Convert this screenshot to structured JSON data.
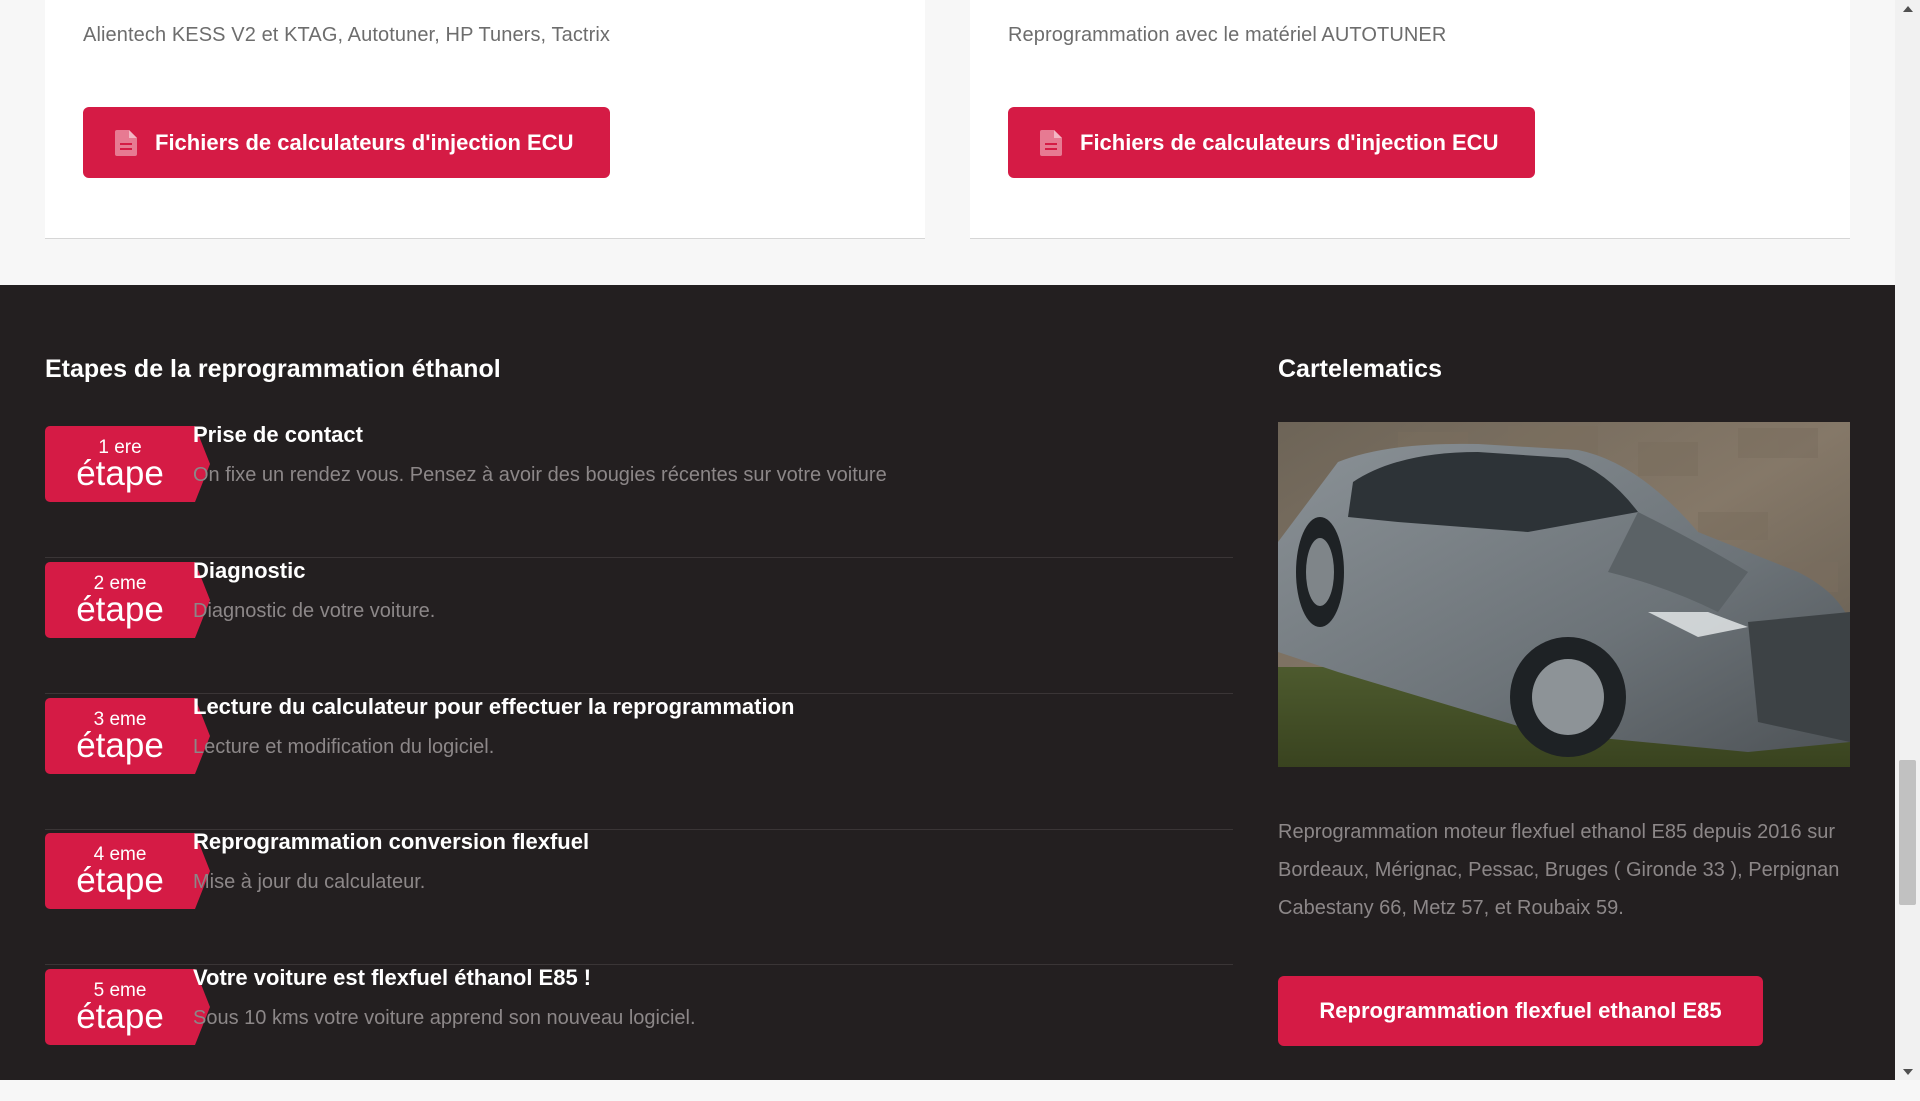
{
  "cards": [
    {
      "text": "Alientech KESS V2 et KTAG, Autotuner, HP Tuners, Tactrix",
      "button_label": "Fichiers de calculateurs d'injection ECU",
      "button_icon": "file-document-icon"
    },
    {
      "text": "Reprogrammation avec le matériel AUTOTUNER",
      "button_label": "Fichiers de calculateurs d'injection ECU",
      "button_icon": "file-document-icon"
    }
  ],
  "steps_section": {
    "title": "Etapes de la reprogrammation éthanol",
    "steps": [
      {
        "number": "1 ere",
        "word": "étape",
        "title": "Prise de contact",
        "description": "On fixe un rendez vous. Pensez à avoir des bougies récentes sur votre voiture"
      },
      {
        "number": "2 eme",
        "word": "étape",
        "title": "Diagnostic",
        "description": "Diagnostic de votre voiture."
      },
      {
        "number": "3 eme",
        "word": "étape",
        "title": "Lecture du calculateur pour effectuer la reprogrammation",
        "description": "Lecture et modification du logiciel."
      },
      {
        "number": "4 eme",
        "word": "étape",
        "title": "Reprogrammation conversion flexfuel",
        "description": "Mise à jour du calculateur."
      },
      {
        "number": "5 eme",
        "word": "étape",
        "title": "Votre voiture est flexfuel éthanol E85 !",
        "description": "Sous 10 kms votre voiture apprend son nouveau logiciel."
      }
    ]
  },
  "cartelematics": {
    "title": "Cartelematics",
    "photo": "grey-audi-wagon-photo",
    "text": "Reprogrammation moteur flexfuel ethanol E85 depuis 2016 sur Bordeaux, Mérignac, Pessac, Bruges ( Gironde 33 ), Perpignan Cabestany 66, Metz 57, et Roubaix 59.",
    "button_label": "Reprogrammation flexfuel ethanol E85"
  },
  "colors": {
    "accent": "#d51b45",
    "dark_bg": "#231f20",
    "light_bg": "#f7f7f7",
    "muted_text": "#8c8788"
  }
}
